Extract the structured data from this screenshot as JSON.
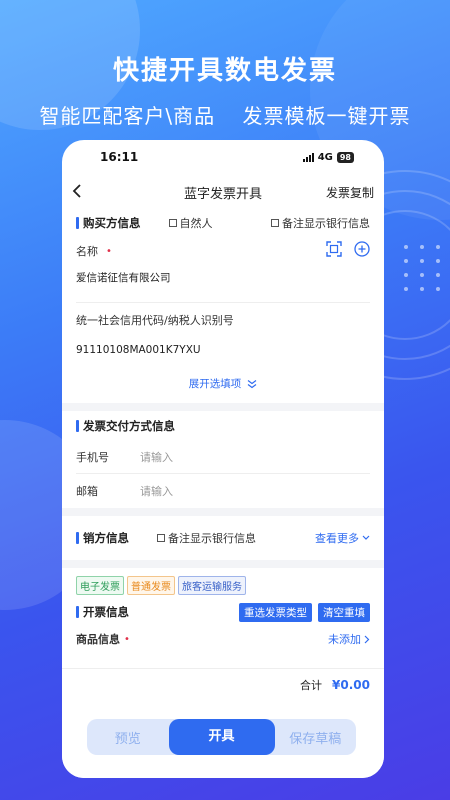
{
  "promo": {
    "headline": "快捷开具数电发票",
    "sub_left": "智能匹配客户\\商品",
    "sub_right": "发票模板一键开票"
  },
  "status_bar": {
    "time": "16:11",
    "network": "4G",
    "battery": "98"
  },
  "nav": {
    "back_icon": "chevron-left-icon",
    "title": "蓝字发票开具",
    "action": "发票复制"
  },
  "buyer": {
    "section_title": "购买方信息",
    "natural_person": "自然人",
    "show_bank": "备注显示银行信息",
    "name_label": "名称",
    "required_mark": "•",
    "name_value": "爱信诺征信有限公司",
    "taxid_label": "统一社会信用代码/纳税人识别号",
    "taxid_value": "91110108MA001K7YXU",
    "expand_label": "展开选填项"
  },
  "delivery": {
    "section_title": "发票交付方式信息",
    "phone_label": "手机号",
    "phone_placeholder": "请输入",
    "email_label": "邮箱",
    "email_placeholder": "请输入"
  },
  "seller": {
    "section_title": "销方信息",
    "show_bank": "备注显示银行信息",
    "more": "查看更多"
  },
  "invoice": {
    "tags": [
      "电子发票",
      "普通发票",
      "旅客运输服务"
    ],
    "section_title": "开票信息",
    "reselect": "重选发票类型",
    "clear": "清空重填",
    "goods_label": "商品信息",
    "goods_add": "未添加"
  },
  "footer": {
    "total_label": "合计",
    "total_value": "¥0.00",
    "preview": "预览",
    "issue": "开具",
    "save_draft": "保存草稿"
  },
  "colors": {
    "accent": "#2f6bf0",
    "required": "#e0304a",
    "tag_green": "#2e9d5a",
    "tag_orange": "#e8891c",
    "tag_blue": "#3a62c8"
  }
}
